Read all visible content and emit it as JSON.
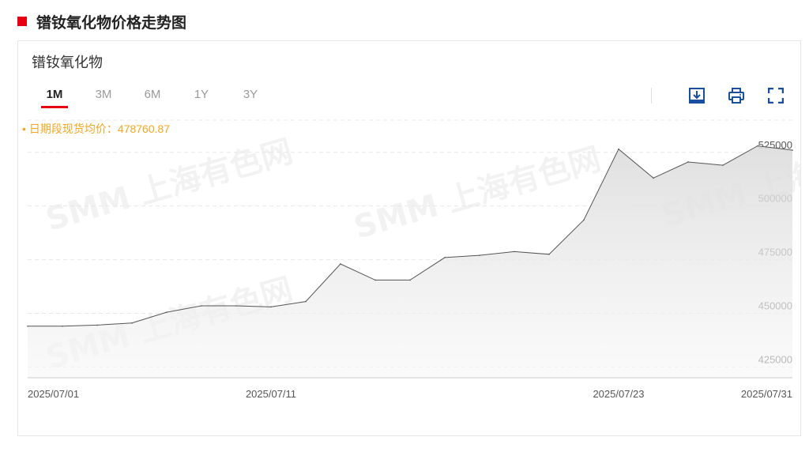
{
  "section": {
    "title": "镨钕氧化物价格走势图"
  },
  "panel": {
    "chart_name": "镨钕氧化物",
    "tabs": [
      {
        "label": "1M",
        "active": true
      },
      {
        "label": "3M",
        "active": false
      },
      {
        "label": "6M",
        "active": false
      },
      {
        "label": "1Y",
        "active": false
      },
      {
        "label": "3Y",
        "active": false
      }
    ],
    "toolbar": [
      "download-icon",
      "print-icon",
      "fullscreen-icon"
    ],
    "avg_label": "日期段现货均价：478760.87",
    "watermark": "SMM 上海有色网"
  },
  "colors": {
    "accent": "#e60012",
    "avg": "#f5a623",
    "icon": "#1a4fa0",
    "line": "#555555"
  },
  "chart_data": {
    "type": "area",
    "x_ticks": [
      "2025/07/01",
      "2025/07/11",
      "2025/07/23",
      "2025/07/31"
    ],
    "x_tick_index": [
      0,
      7,
      17,
      22
    ],
    "y_ticks": [
      "425000",
      "450000",
      "475000",
      "500000",
      "525000"
    ],
    "ylim": [
      420000,
      540000
    ],
    "x": [
      "2025/07/01",
      "2025/07/02",
      "2025/07/03",
      "2025/07/04",
      "2025/07/07",
      "2025/07/08",
      "2025/07/09",
      "2025/07/10",
      "2025/07/11",
      "2025/07/14",
      "2025/07/15",
      "2025/07/16",
      "2025/07/17",
      "2025/07/18",
      "2025/07/21",
      "2025/07/22",
      "2025/07/23",
      "2025/07/24",
      "2025/07/25",
      "2025/07/28",
      "2025/07/29",
      "2025/07/30",
      "2025/07/31"
    ],
    "values": [
      444000,
      444000,
      444500,
      445500,
      450500,
      453500,
      453500,
      453000,
      455500,
      473000,
      465500,
      465500,
      476000,
      477000,
      478750,
      477500,
      493500,
      526500,
      513000,
      520500,
      519000,
      528000,
      526000
    ],
    "grid": true,
    "legend": "none"
  }
}
